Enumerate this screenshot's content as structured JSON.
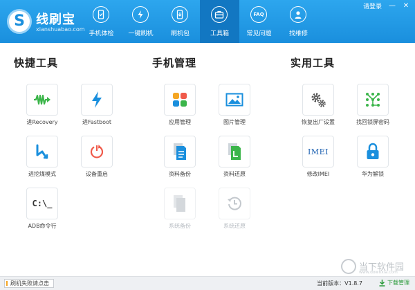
{
  "app": {
    "logo_char": "S",
    "title": "线刷宝",
    "subtitle": "xianshuabao.com"
  },
  "nav": [
    {
      "label": "手机体检",
      "icon": "phone-check-icon"
    },
    {
      "label": "一键刷机",
      "icon": "flash-icon"
    },
    {
      "label": "刷机包",
      "icon": "package-icon"
    },
    {
      "label": "工具箱",
      "icon": "toolbox-icon",
      "active": true
    },
    {
      "label": "常见问题",
      "icon": "faq-icon"
    },
    {
      "label": "找维修",
      "icon": "repair-person-icon"
    }
  ],
  "window": {
    "login": "请登录",
    "minimize": "—",
    "close": "✕"
  },
  "sections": {
    "quick": "快捷工具",
    "phone": "手机管理",
    "util": "实用工具"
  },
  "tools": {
    "recovery": "进Recovery",
    "fastboot": "进Fastboot",
    "edl": "进挖煤模式",
    "reboot": "设备重启",
    "adb": "ADB命令行",
    "apps": "应用管理",
    "photos": "图片管理",
    "backup": "资料备份",
    "restore": "资料还原",
    "sys_backup": "系统备份",
    "sys_restore": "系统还原",
    "factory": "恢复出厂设置",
    "unlock_pattern": "找回锁屏密码",
    "imei": "修改IMEI",
    "huawei": "华为解锁"
  },
  "icons": {
    "adb_text": "C:\\_",
    "imei_text": "IMEI"
  },
  "status": {
    "left": "刷机失败请点击",
    "version": "当前版本：V1.8.7",
    "download": "下载管理"
  },
  "watermark": {
    "text": "当下软件园",
    "url": "www.downxia.com"
  },
  "colors": {
    "header": "#1a8fdd",
    "active_tab": "#1277c2",
    "green": "#3bb54a",
    "blue": "#1a8fdd",
    "red": "#f05a4a"
  }
}
